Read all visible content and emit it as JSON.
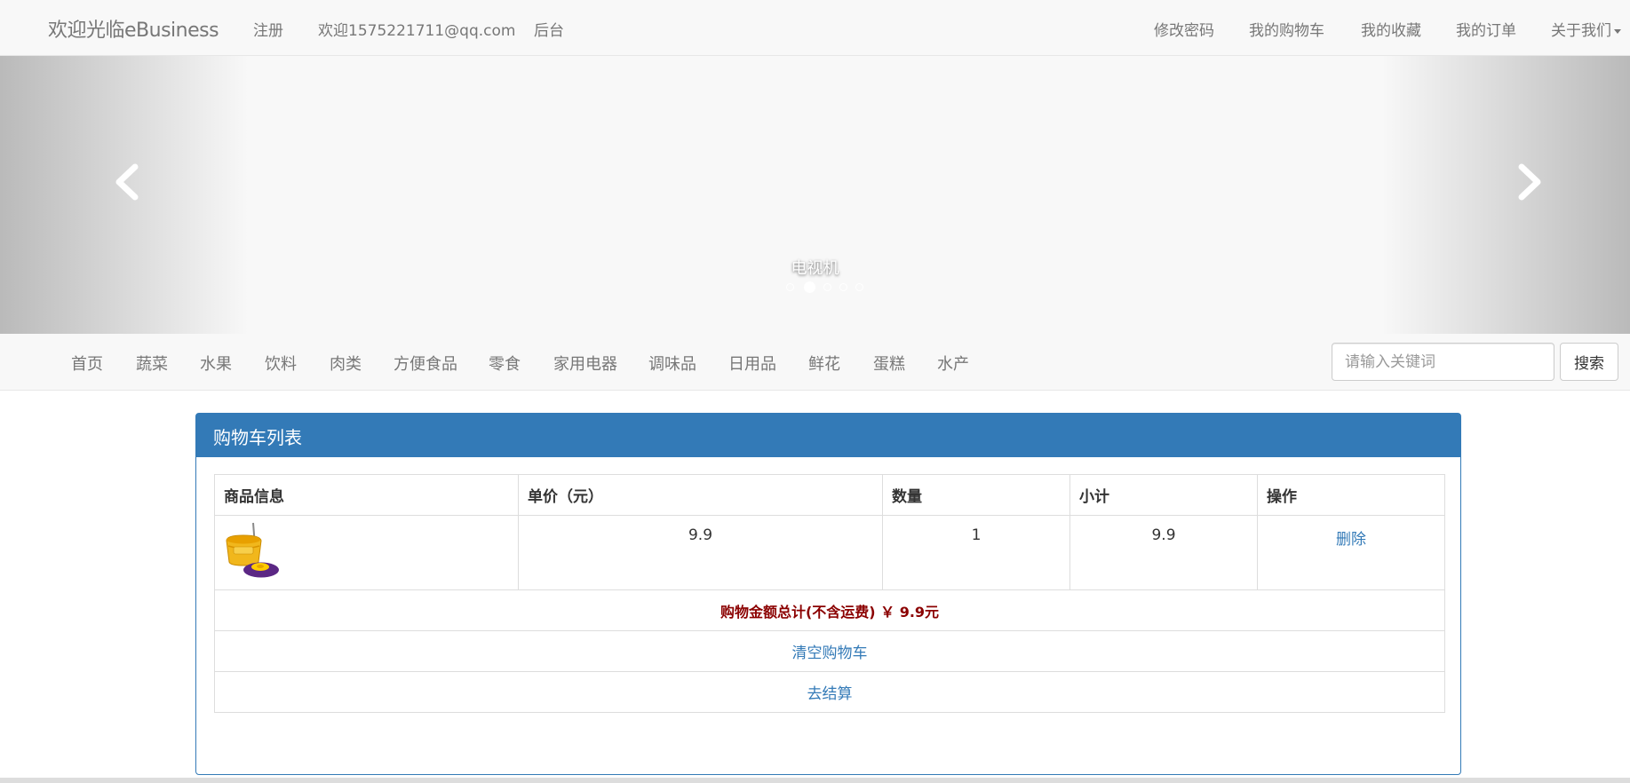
{
  "topnav": {
    "brand": "欢迎光临eBusiness",
    "register": "注册",
    "welcome_user": "欢迎1575221711@qq.com",
    "admin": "后台",
    "change_password": "修改密码",
    "my_cart": "我的购物车",
    "my_favorites": "我的收藏",
    "my_orders": "我的订单",
    "about_us": "关于我们"
  },
  "carousel": {
    "caption": "电视机",
    "indicator_count": 5,
    "active_indicator": 1
  },
  "categories": [
    "首页",
    "蔬菜",
    "水果",
    "饮料",
    "肉类",
    "方便食品",
    "零食",
    "家用电器",
    "调味品",
    "日用品",
    "鲜花",
    "蛋糕",
    "水产"
  ],
  "search": {
    "placeholder": "请输入关键词",
    "button_label": "搜索"
  },
  "cart": {
    "title": "购物车列表",
    "columns": [
      "商品信息",
      "单价（元）",
      "数量",
      "小计",
      "操作"
    ],
    "items": [
      {
        "product_icon": "mop-bucket-image",
        "price": "9.9",
        "quantity": "1",
        "subtotal": "9.9",
        "action": "删除"
      }
    ],
    "total_text": "购物金额总计(不含运费) ￥ 9.9元",
    "clear_cart": "清空购物车",
    "checkout": "去结算"
  },
  "colors": {
    "primary": "#337ab7",
    "nav_bg": "#f8f8f8",
    "nav_text": "#777777",
    "total_text": "#8b0000"
  }
}
